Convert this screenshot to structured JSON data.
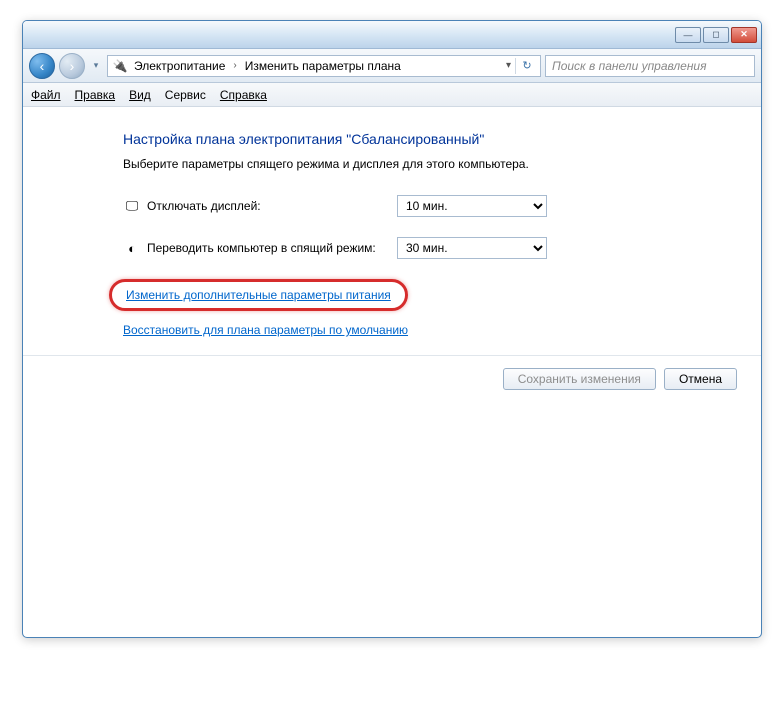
{
  "titlebar": {
    "minimize": "—",
    "maximize": "◻",
    "close": "✕"
  },
  "nav": {
    "back": "‹",
    "forward": "›",
    "dropdown": "▾",
    "refresh": "↻",
    "breadcrumb_root": "Электропитание",
    "breadcrumb_arrow": "›",
    "breadcrumb_leaf": "Изменить параметры плана",
    "search_placeholder": "Поиск в панели управления"
  },
  "menu": {
    "file": "Файл",
    "edit": "Правка",
    "view": "Вид",
    "service": "Сервис",
    "help": "Справка"
  },
  "page": {
    "heading": "Настройка плана электропитания \"Сбалансированный\"",
    "subtitle": "Выберите параметры спящего режима и дисплея для этого компьютера.",
    "display_off_label": "Отключать дисплей:",
    "display_off_value": "10 мин.",
    "sleep_label": "Переводить компьютер в спящий режим:",
    "sleep_value": "30 мин.",
    "link_advanced": "Изменить дополнительные параметры питания",
    "link_restore": "Восстановить для плана параметры по умолчанию"
  },
  "footer": {
    "save": "Сохранить изменения",
    "cancel": "Отмена"
  },
  "icons": {
    "power": "🔌",
    "display": "🖵",
    "moon": "◐"
  }
}
